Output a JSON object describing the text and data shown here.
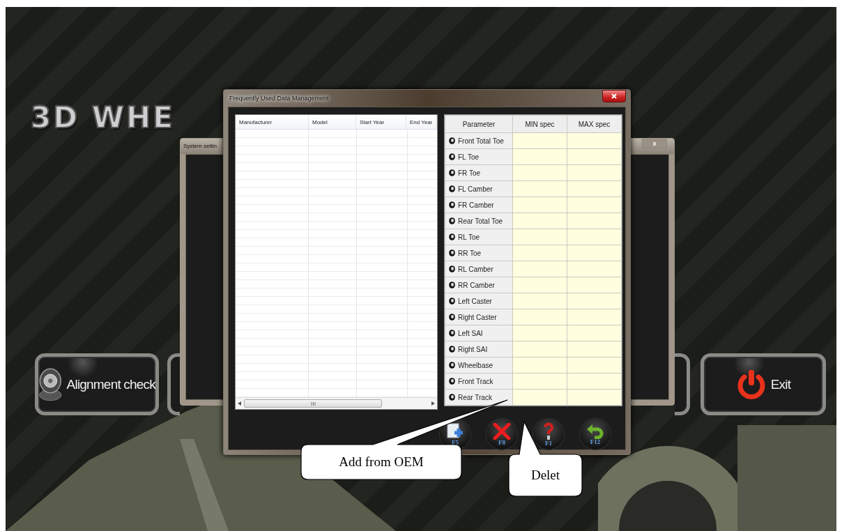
{
  "logo": {
    "text": "3D WHE"
  },
  "background_window": {
    "title": "System settin",
    "close": "x"
  },
  "menu_tiles": [
    {
      "kind": "alignment",
      "label": "Alignment check"
    },
    {
      "kind": "exit",
      "label": "Exit"
    }
  ],
  "dialog": {
    "title": "Frequently Used Data Management",
    "vehicle_table": {
      "columns": [
        "Manufacturer",
        "Model",
        "Start Year",
        "End Year"
      ]
    },
    "spec_table": {
      "columns": [
        "Parameter",
        "MIN spec",
        "MAX spec"
      ],
      "rows": [
        {
          "parameter": "Front Total Toe"
        },
        {
          "parameter": "FL Toe"
        },
        {
          "parameter": "FR Toe"
        },
        {
          "parameter": "FL Camber"
        },
        {
          "parameter": "FR Camber"
        },
        {
          "parameter": "Rear Total Toe"
        },
        {
          "parameter": "RL Toe"
        },
        {
          "parameter": "RR Toe"
        },
        {
          "parameter": "RL Camber"
        },
        {
          "parameter": "RR Camber"
        },
        {
          "parameter": "Left Caster"
        },
        {
          "parameter": "Right Caster"
        },
        {
          "parameter": "Left SAI"
        },
        {
          "parameter": "Right SAI"
        },
        {
          "parameter": "Wheelbase"
        },
        {
          "parameter": "Front Track"
        },
        {
          "parameter": "Rear Track"
        }
      ]
    },
    "toolbar": [
      {
        "kind": "add",
        "key": "F5"
      },
      {
        "kind": "delete",
        "key": "F8"
      },
      {
        "kind": "help",
        "key": "F1"
      },
      {
        "kind": "back",
        "key": "F12"
      }
    ]
  },
  "callouts": [
    {
      "kind": "wide",
      "text": "Add from OEM"
    },
    {
      "kind": "narrow",
      "text": "Delet"
    }
  ]
}
